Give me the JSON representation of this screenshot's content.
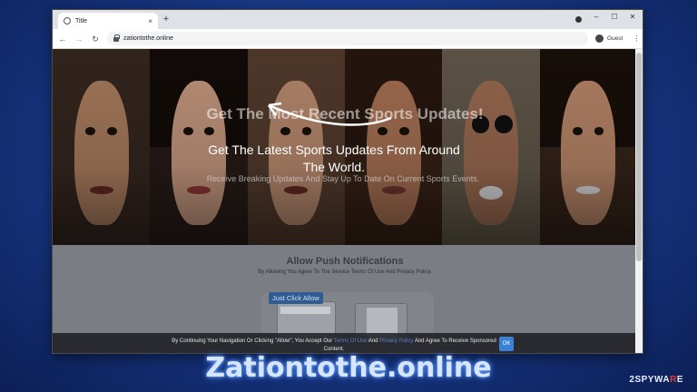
{
  "browser": {
    "tab_title": "Title",
    "tab_close": "×",
    "new_tab": "+",
    "address": "zationtothe.online",
    "profile_label": "Guest",
    "icons": {
      "tab": "globe-icon",
      "back": "back-arrow-icon",
      "forward": "forward-arrow-icon",
      "reload": "reload-icon",
      "lock": "lock-icon",
      "profile": "avatar-icon",
      "menu": "kebab-menu-icon"
    },
    "window_controls": [
      "–",
      "☐",
      "✕"
    ]
  },
  "hero": {
    "headline": "Get The Most Recent Sports Updates!",
    "subheadline": "Get The Latest Sports Updates From Around The World.",
    "tagline": "Receive Breaking Updates And Stay Up To Date On Current Sports Events."
  },
  "push": {
    "title": "Allow Push Notifications",
    "subtitle": "By Allowing You Agree To The Service Terms Of Use And Privacy Policy.",
    "badge": "Just Click Allow"
  },
  "consent": {
    "text_start": "By Continuing Your Navigation Or Clicking \"Allow\", You Accept Our",
    "link1": "Terms Of Use",
    "and1": "And",
    "link2": "Privacy Policy",
    "text_end": "And Agree To Receive Sponsored Content.",
    "ok_label": "OK"
  },
  "caption": "Zationtothe.online",
  "watermark": {
    "prefix": "2SPYWA",
    "accent": "R",
    "suffix": "E"
  },
  "colors": {
    "accent_blue": "#3b82d6",
    "badge_blue": "#2f5d91",
    "caption_glow": "#6fa4ff",
    "watermark_red": "#e23b3b"
  }
}
